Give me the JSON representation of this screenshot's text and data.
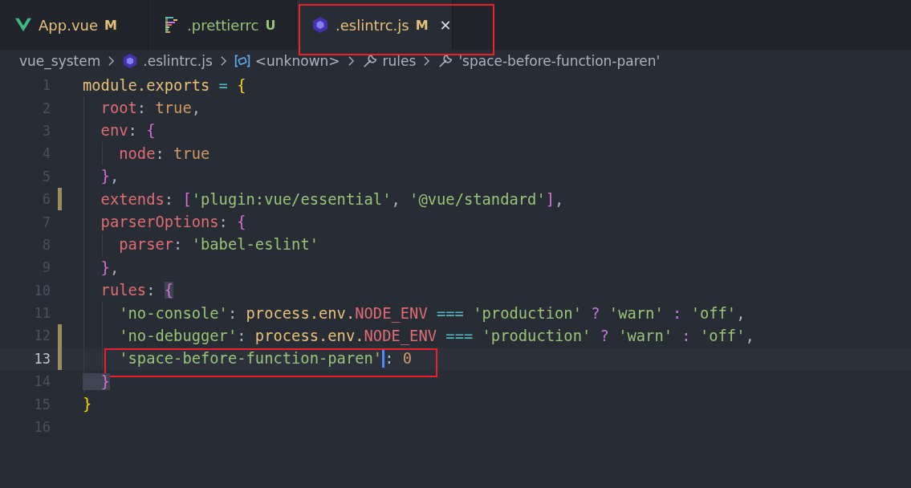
{
  "tabs": [
    {
      "label": "App.vue",
      "badge": "M",
      "kind": "vue",
      "selected": false
    },
    {
      "label": ".prettierrc",
      "badge": "U",
      "kind": "prettier",
      "selected": false
    },
    {
      "label": ".eslintrc.js",
      "badge": "M",
      "kind": "eslint",
      "selected": true,
      "boxed": true,
      "close": "✕"
    }
  ],
  "breadcrumb": [
    {
      "label": "vue_system",
      "kind": "folder"
    },
    {
      "label": ".eslintrc.js",
      "kind": "eslint"
    },
    {
      "label": "<unknown>",
      "kind": "object"
    },
    {
      "label": "rules",
      "kind": "wrench"
    },
    {
      "label": "'space-before-function-paren'",
      "kind": "wrench"
    }
  ],
  "lines": [
    {
      "number": "1",
      "modified": false,
      "current": false,
      "tokens": [
        {
          "t": "module.exports",
          "kind": "var"
        },
        {
          "t": " = ",
          "kind": "op"
        },
        {
          "t": "{",
          "kind": "b1"
        }
      ]
    },
    {
      "number": "2",
      "modified": false,
      "current": false,
      "tokens": [
        {
          "t": "  root",
          "kind": "key"
        },
        {
          "t": ": ",
          "kind": "p"
        },
        {
          "t": "true",
          "kind": "lit"
        },
        {
          "t": ",",
          "kind": "p"
        }
      ]
    },
    {
      "number": "3",
      "modified": false,
      "current": false,
      "tokens": [
        {
          "t": "  env",
          "kind": "key"
        },
        {
          "t": ": ",
          "kind": "p"
        },
        {
          "t": "{",
          "kind": "b2"
        }
      ]
    },
    {
      "number": "4",
      "modified": false,
      "current": false,
      "tokens": [
        {
          "t": "    node",
          "kind": "key"
        },
        {
          "t": ": ",
          "kind": "p"
        },
        {
          "t": "true",
          "kind": "lit"
        }
      ]
    },
    {
      "number": "5",
      "modified": false,
      "current": false,
      "tokens": [
        {
          "t": "  }",
          "kind": "b2"
        },
        {
          "t": ",",
          "kind": "p"
        }
      ]
    },
    {
      "number": "6",
      "modified": true,
      "current": false,
      "tokens": [
        {
          "t": "  extends",
          "kind": "key"
        },
        {
          "t": ": ",
          "kind": "p"
        },
        {
          "t": "[",
          "kind": "b2"
        },
        {
          "t": "'plugin:vue/essential'",
          "kind": "str"
        },
        {
          "t": ", ",
          "kind": "p"
        },
        {
          "t": "'@vue/standard'",
          "kind": "str"
        },
        {
          "t": "]",
          "kind": "b2"
        },
        {
          "t": ",",
          "kind": "p"
        }
      ]
    },
    {
      "number": "7",
      "modified": false,
      "current": false,
      "tokens": [
        {
          "t": "  parserOptions",
          "kind": "key"
        },
        {
          "t": ": ",
          "kind": "p"
        },
        {
          "t": "{",
          "kind": "b2"
        }
      ]
    },
    {
      "number": "8",
      "modified": false,
      "current": false,
      "tokens": [
        {
          "t": "    parser",
          "kind": "key"
        },
        {
          "t": ": ",
          "kind": "p"
        },
        {
          "t": "'babel-eslint'",
          "kind": "str"
        }
      ]
    },
    {
      "number": "9",
      "modified": false,
      "current": false,
      "tokens": [
        {
          "t": "  }",
          "kind": "b2"
        },
        {
          "t": ",",
          "kind": "p"
        }
      ]
    },
    {
      "number": "10",
      "modified": false,
      "current": false,
      "tokens": [
        {
          "t": "  rules",
          "kind": "key"
        },
        {
          "t": ": ",
          "kind": "p"
        },
        {
          "t": "{",
          "kind": "b2m"
        }
      ]
    },
    {
      "number": "11",
      "modified": false,
      "current": false,
      "tokens": [
        {
          "t": "    'no-console'",
          "kind": "str"
        },
        {
          "t": ": ",
          "kind": "p"
        },
        {
          "t": "process.env.",
          "kind": "var"
        },
        {
          "t": "NODE_ENV",
          "kind": "key"
        },
        {
          "t": " === ",
          "kind": "op"
        },
        {
          "t": "'production'",
          "kind": "str"
        },
        {
          "t": " ? ",
          "kind": "kw"
        },
        {
          "t": "'warn'",
          "kind": "str"
        },
        {
          "t": " : ",
          "kind": "kw"
        },
        {
          "t": "'off'",
          "kind": "str"
        },
        {
          "t": ",",
          "kind": "p"
        }
      ]
    },
    {
      "number": "12",
      "modified": true,
      "current": false,
      "tokens": [
        {
          "t": "    'no-debugger'",
          "kind": "str"
        },
        {
          "t": ": ",
          "kind": "p"
        },
        {
          "t": "process.env.",
          "kind": "var"
        },
        {
          "t": "NODE_ENV",
          "kind": "key"
        },
        {
          "t": " === ",
          "kind": "op"
        },
        {
          "t": "'production'",
          "kind": "str"
        },
        {
          "t": " ? ",
          "kind": "kw"
        },
        {
          "t": "'warn'",
          "kind": "str"
        },
        {
          "t": " : ",
          "kind": "kw"
        },
        {
          "t": "'off'",
          "kind": "str"
        },
        {
          "t": ",",
          "kind": "p"
        }
      ]
    },
    {
      "number": "13",
      "modified": true,
      "current": true,
      "boxed": true,
      "tokens": [
        {
          "t": "    'space-before-function-paren'",
          "kind": "str",
          "cursor": true
        },
        {
          "t": ": ",
          "kind": "p"
        },
        {
          "t": "0",
          "kind": "lit"
        }
      ]
    },
    {
      "number": "14",
      "modified": false,
      "current": false,
      "tokens": [
        {
          "t": "  }",
          "kind": "b2m"
        }
      ]
    },
    {
      "number": "15",
      "modified": false,
      "current": false,
      "tokens": [
        {
          "t": "}",
          "kind": "b1"
        }
      ]
    },
    {
      "number": "16",
      "modified": false,
      "current": false
    }
  ]
}
